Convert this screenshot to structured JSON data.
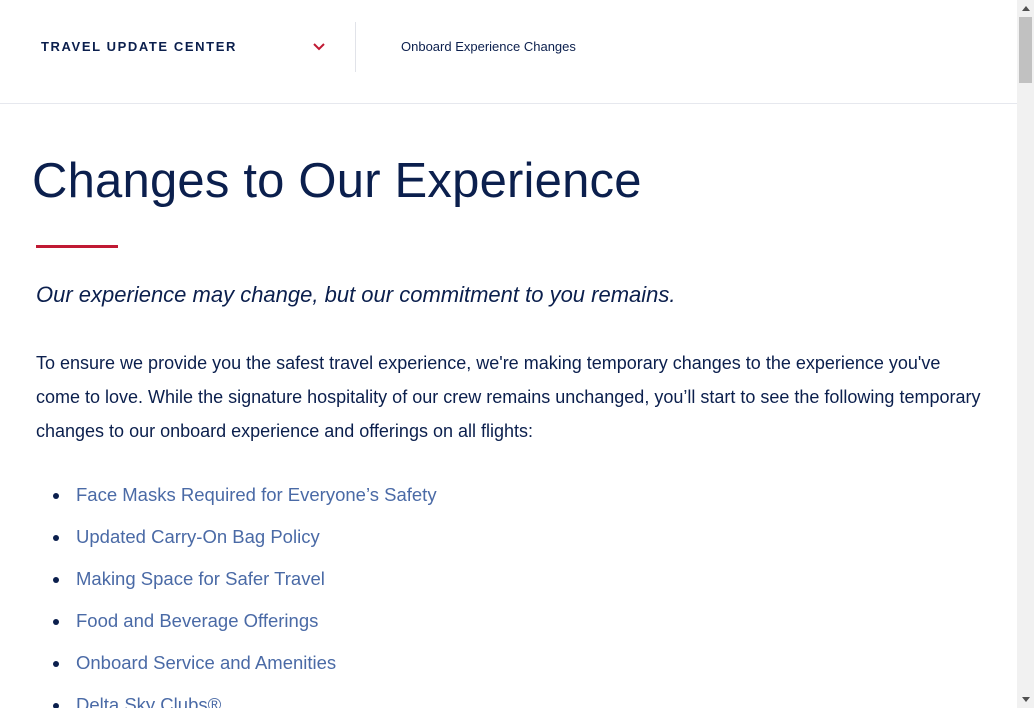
{
  "topbar": {
    "section_title": "TRAVEL UPDATE CENTER",
    "breadcrumb": "Onboard Experience Changes"
  },
  "main": {
    "title": "Changes to Our Experience",
    "subtitle": "Our experience may change, but our commitment to you remains.",
    "intro": "To ensure we provide you the safest travel experience, we're making temporary changes to the experience you've come to love. While the signature hospitality of our crew remains unchanged, you’ll start to see the following temporary changes to our onboard experience and offerings on all flights:",
    "links": [
      "Face Masks Required for Everyone’s Safety",
      "Updated Carry-On Bag Policy",
      "Making Space for Safer Travel",
      "Food and Beverage Offerings",
      "Onboard Service and Amenities",
      "Delta Sky Clubs®"
    ]
  },
  "colors": {
    "navy": "#0b1f4d",
    "accent_red": "#c01933",
    "link_blue": "#4a6aa6"
  },
  "icons": {
    "dropdown": "chevron-down-icon"
  }
}
